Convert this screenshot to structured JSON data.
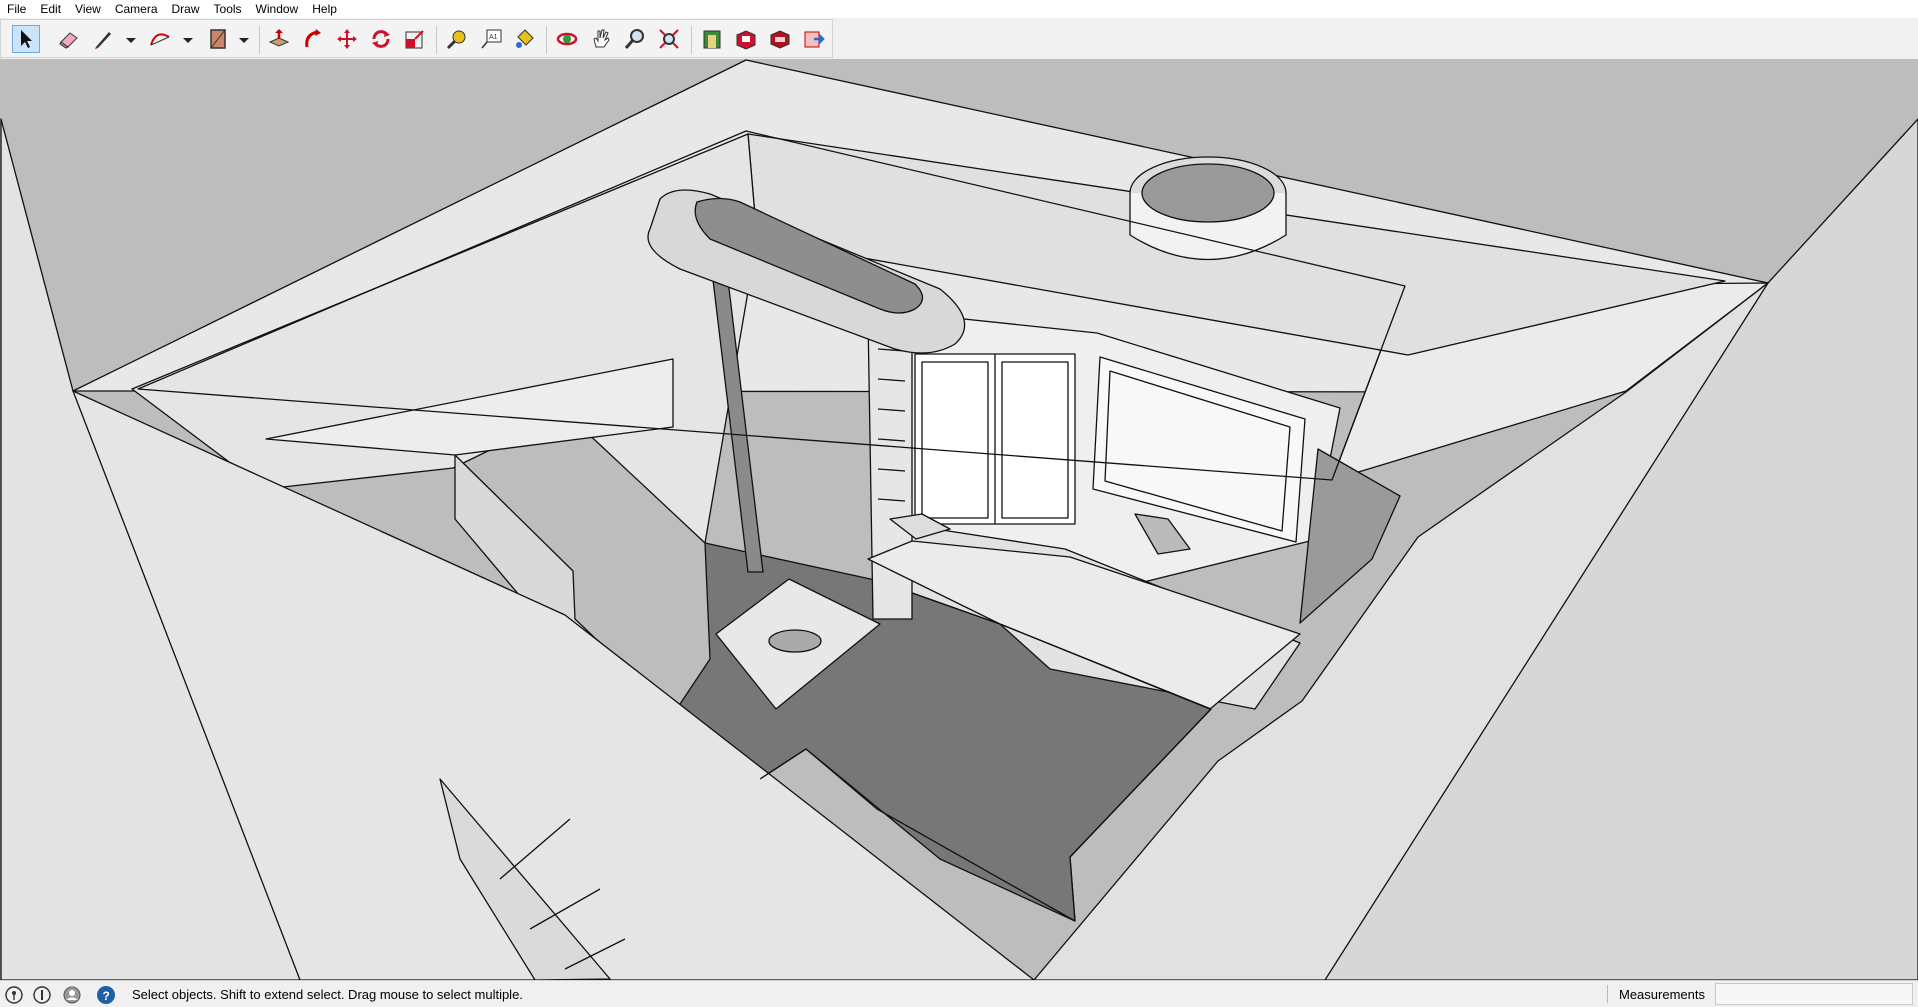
{
  "menu": [
    "File",
    "Edit",
    "View",
    "Camera",
    "Draw",
    "Tools",
    "Window",
    "Help"
  ],
  "toolbar": {
    "tools": [
      "select",
      "eraser",
      "line",
      "line-menu",
      "arc",
      "arc-menu",
      "rectangle",
      "rectangle-menu",
      "push-pull",
      "follow-me",
      "move",
      "rotate",
      "scale",
      "tape-measure",
      "text",
      "paint-bucket",
      "orbit",
      "pan",
      "zoom",
      "zoom-extents",
      "warehouse",
      "extension-warehouse",
      "send-to-layout",
      "extension-manager"
    ],
    "active_tool": "select"
  },
  "viewport": {
    "background": "#bdbdbd",
    "wall_color": "#e6e6e6",
    "floor_color": "#777777",
    "edge_color": "#111111"
  },
  "status": {
    "icons": [
      "geo-location-icon",
      "credits-icon",
      "user-icon",
      "help-icon"
    ],
    "message": "Select objects. Shift to extend select. Drag mouse to select multiple.",
    "measurements_label": "Measurements",
    "measurements_value": ""
  }
}
